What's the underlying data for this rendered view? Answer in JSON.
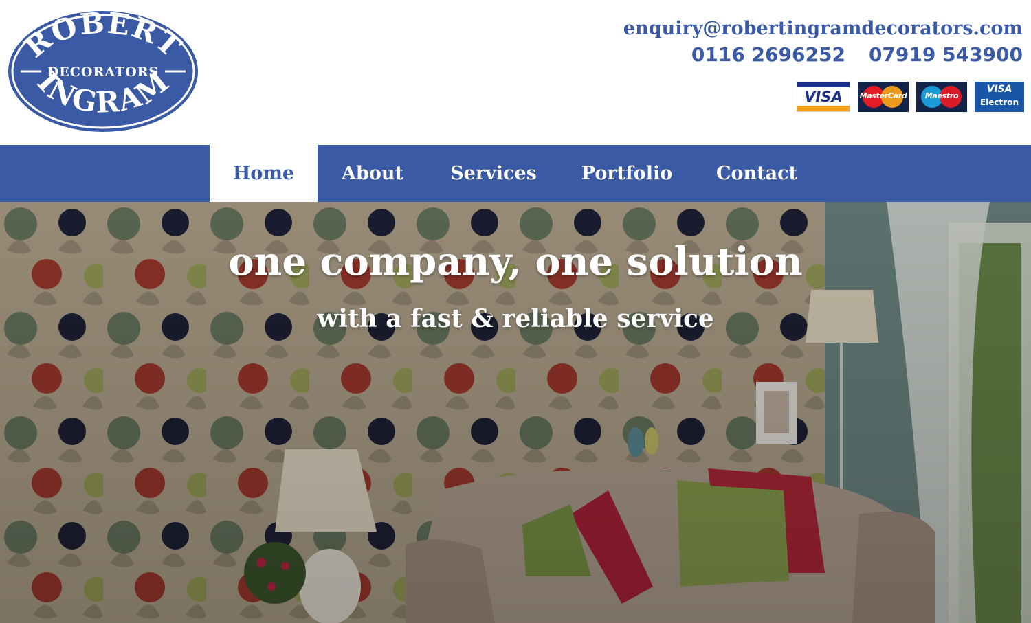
{
  "brand": {
    "logo_top": "ROBERT",
    "logo_middle": "DECORATORS",
    "logo_bottom": "INGRAM",
    "color": "#3a5aa6"
  },
  "contact": {
    "email": "enquiry@robertingramdecorators.com",
    "phone_1": "0116 2696252",
    "phone_2": "07919 543900"
  },
  "payment_cards": {
    "visa": "VISA",
    "mastercard": "MasterCard",
    "maestro": "Maestro",
    "visa_electron_top": "VISA",
    "visa_electron_bottom": "Electron"
  },
  "nav": {
    "items": [
      {
        "label": "Home",
        "active": true
      },
      {
        "label": "About",
        "active": false
      },
      {
        "label": "Services",
        "active": false
      },
      {
        "label": "Portfolio",
        "active": false
      },
      {
        "label": "Contact",
        "active": false
      }
    ]
  },
  "hero": {
    "title": "one company, one solution",
    "subtitle": "with a fast & reliable service"
  }
}
